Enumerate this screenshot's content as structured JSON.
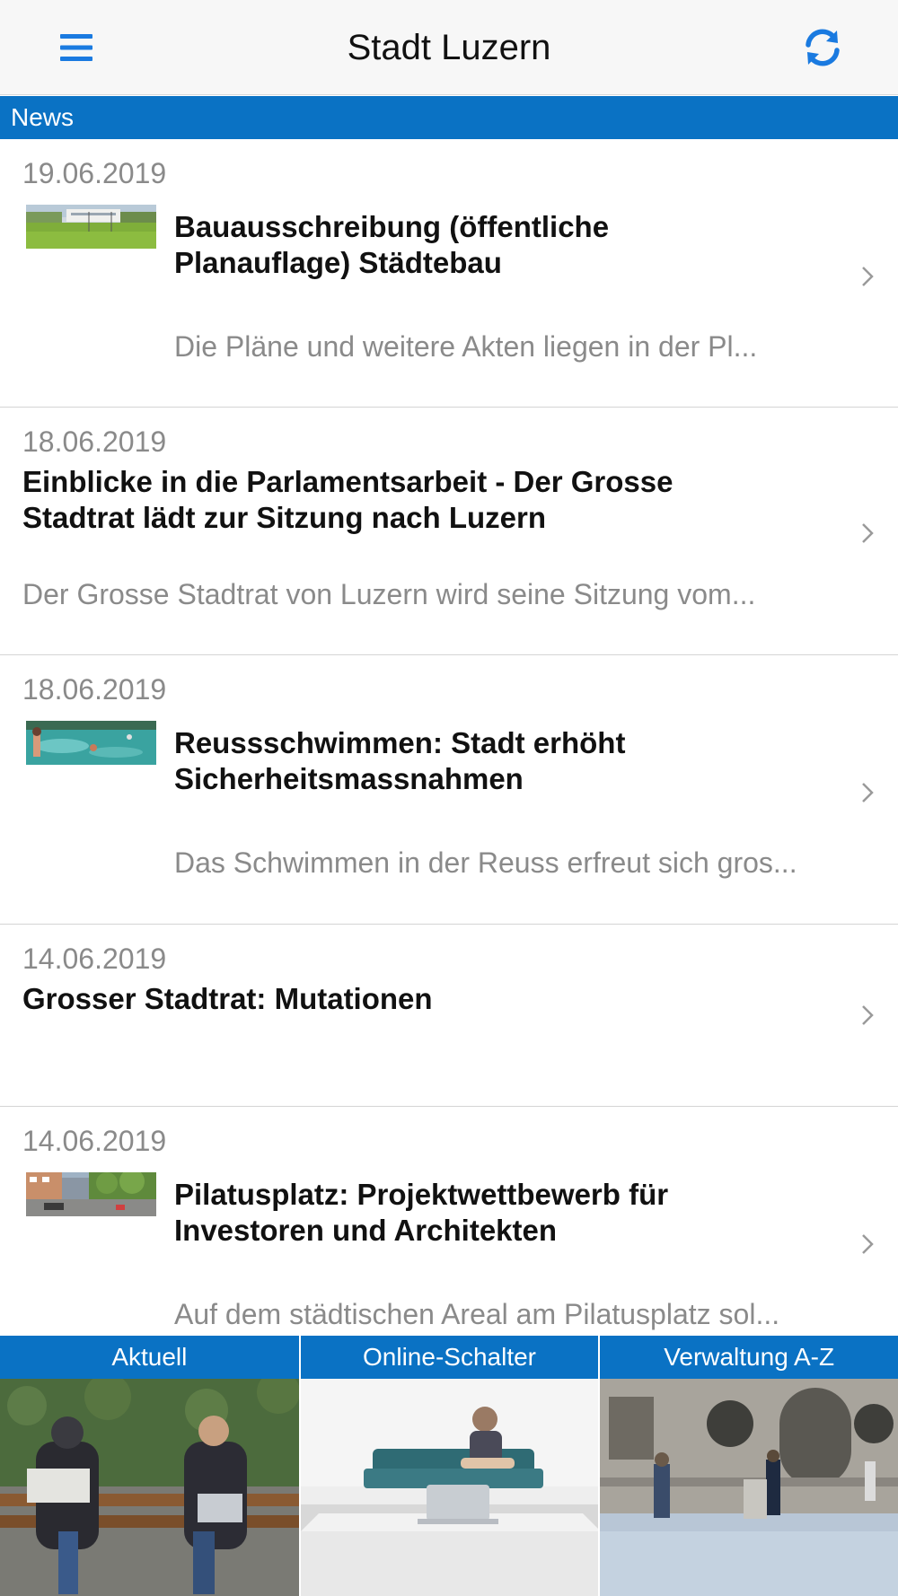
{
  "app": {
    "title": "Stadt Luzern",
    "menu_icon": "hamburger-menu-icon",
    "refresh_icon": "refresh-icon",
    "accent_color": "#0a72c4"
  },
  "section": {
    "title": "News"
  },
  "news": [
    {
      "date": "19.06.2019",
      "title": "Bauausschreibung (öffentliche Planauflage) Städtebau",
      "excerpt": "Die Pläne und weitere Akten liegen in der Pl...",
      "has_thumbnail": true
    },
    {
      "date": "18.06.2019",
      "title": "Einblicke in die Parlamentsarbeit - Der Grosse Stadtrat lädt zur Sitzung nach Luzern",
      "excerpt": "Der Grosse Stadtrat von Luzern wird seine Sitzung vom...",
      "has_thumbnail": false
    },
    {
      "date": "18.06.2019",
      "title": "Reussschwimmen: Stadt erhöht Sicherheitsmassnahmen",
      "excerpt": "Das Schwimmen in der Reuss erfreut sich gros...",
      "has_thumbnail": true
    },
    {
      "date": "14.06.2019",
      "title": "Grosser Stadtrat: Mutationen",
      "excerpt": "",
      "has_thumbnail": false
    },
    {
      "date": "14.06.2019",
      "title": "Pilatusplatz: Projektwettbewerb für Investoren und Architekten",
      "excerpt": "Auf dem städtischen Areal am Pilatusplatz sol...",
      "has_thumbnail": true
    }
  ],
  "tiles": [
    {
      "label": "Aktuell"
    },
    {
      "label": "Online-Schalter"
    },
    {
      "label": "Verwaltung A-Z"
    }
  ]
}
